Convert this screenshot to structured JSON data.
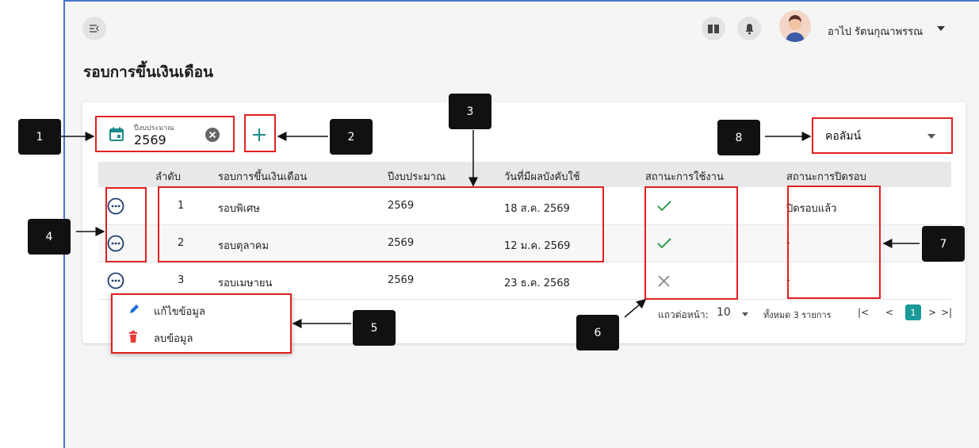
{
  "header": {
    "user_name": "อาไป รัตนกุณาพรรณ",
    "page_title": "รอบการขึ้นเงินเดือน"
  },
  "filters": {
    "year_label": "ปีงบประมาณ",
    "year_value": "2569",
    "column_select": "คอลัมน์"
  },
  "table": {
    "columns": [
      "ลำดับ",
      "รอบการขึ้นเงินเดือน",
      "ปีงบประมาณ",
      "วันที่มีผลบังคับใช้",
      "สถานะการใช้งาน",
      "สถานะการปิดรอบ"
    ],
    "rows": [
      {
        "no": "1",
        "round": "รอบพิเศษ",
        "year": "2569",
        "effective": "18 ส.ค. 2569",
        "active": true,
        "close_status": "ปิดรอบแล้ว"
      },
      {
        "no": "2",
        "round": "รอบตุลาคม",
        "year": "2569",
        "effective": "12 ม.ค. 2569",
        "active": true,
        "close_status": "-"
      },
      {
        "no": "3",
        "round": "รอบเมษายน",
        "year": "2569",
        "effective": "23 ธ.ค. 2568",
        "active": false,
        "close_status": "-"
      }
    ]
  },
  "pagination": {
    "rows_per_page_label": "แถวต่อหน้า:",
    "rows_per_page": "10",
    "total_label": "ทั้งหมด 3 รายการ",
    "first": "|<",
    "prev": "<",
    "current_page": "1",
    "next": ">",
    "last": ">|"
  },
  "context_menu": {
    "edit_label": "แก้ไขข้อมูล",
    "delete_label": "ลบข้อมูล"
  },
  "annotations": [
    "1",
    "2",
    "3",
    "4",
    "5",
    "6",
    "7",
    "8"
  ],
  "colors": {
    "accent": "#1b8a8a",
    "annotation_red": "#e02020",
    "delete_red": "#e53935",
    "edit_blue": "#1e6fd9"
  }
}
